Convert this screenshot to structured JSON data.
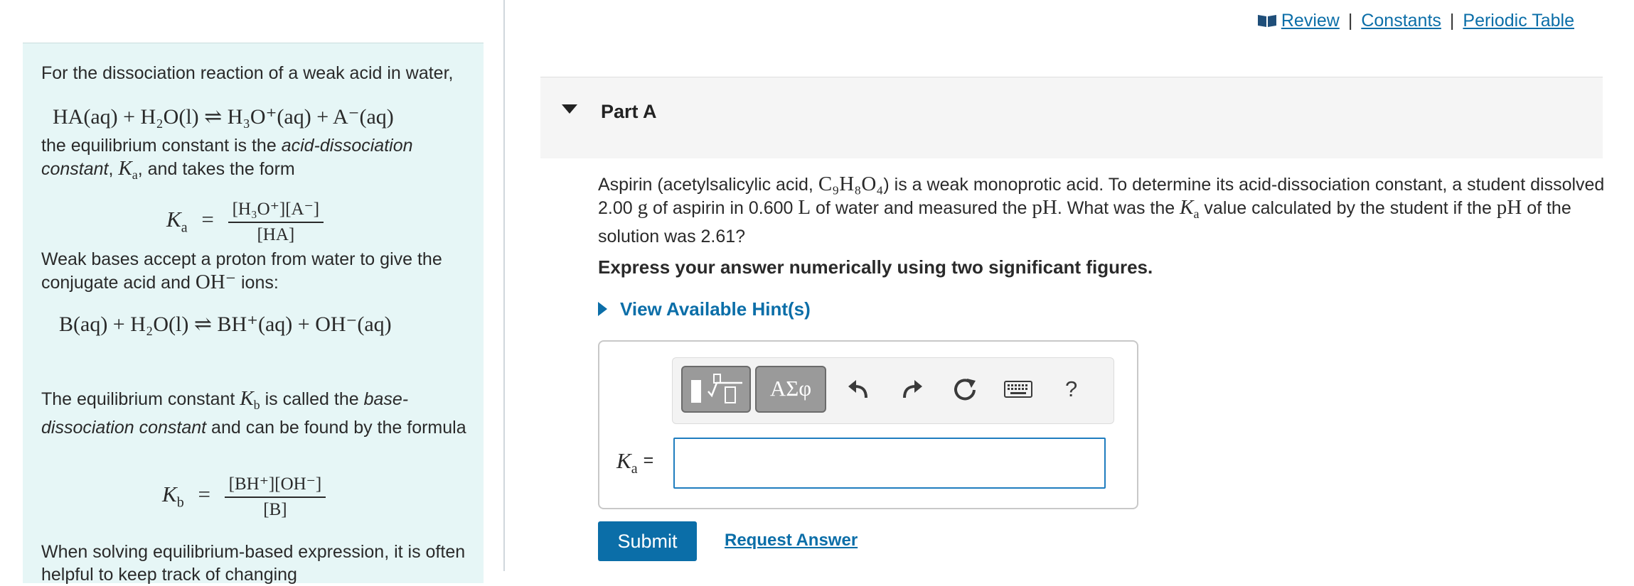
{
  "left_panel": {
    "intro": "For the dissociation reaction of a weak acid in water,",
    "eq_acid_dissociation": "HA(aq) + H₂O(l) ⇌ H₃O⁺(aq) + A⁻(aq)",
    "ka_text_pre": "the equilibrium constant is the ",
    "ka_text_term": "acid-dissociation constant",
    "ka_text_sym": "K",
    "ka_text_sub": "a",
    "ka_text_post": ", and takes the form",
    "ka_formula": {
      "symbol": "K",
      "sub": "a",
      "numerator": "[H₃O⁺][A⁻]",
      "denominator": "[HA]"
    },
    "bases_pre": "Weak bases accept a proton from water to give the conjugate acid and ",
    "bases_ion": "OH⁻",
    "bases_post": " ions:",
    "eq_base_dissociation": "B(aq) + H₂O(l) ⇌ BH⁺(aq) + OH⁻(aq)",
    "kb_text_pre": "The equilibrium constant ",
    "kb_text_sym": "K",
    "kb_text_sub": "b",
    "kb_text_mid": " is called the ",
    "kb_text_term": "base-dissociation constant",
    "kb_text_post": " and can be found by the formula",
    "kb_formula": {
      "symbol": "K",
      "sub": "b",
      "numerator": "[BH⁺][OH⁻]",
      "denominator": "[B]"
    },
    "solving_text": "When solving equilibrium-based expression, it is often helpful to keep track of changing"
  },
  "top_links": {
    "review": "Review",
    "separator": "|",
    "constants": "Constants",
    "periodic_table": "Periodic Table"
  },
  "part": {
    "title": "Part A"
  },
  "question": {
    "text1": "Aspirin (acetylsalicylic acid, ",
    "formula": "C₉H₈O₄",
    "text2": ") is a weak monoprotic acid. To determine its acid-dissociation constant, a student dissolved 2.00 ",
    "unit_g": "g",
    "text3": " of aspirin in 0.600 ",
    "unit_l": "L",
    "text4": " of water and measured the ",
    "ph1": "pH",
    "text5": ". What was the ",
    "ka_sym": "K",
    "ka_sub": "a",
    "text6": " value calculated by the student if the ",
    "ph2": "pH",
    "text7": " of the solution was 2.61?"
  },
  "instruction": "Express your answer numerically using two significant figures.",
  "hint_label": "View Available Hint(s)",
  "toolbar": {
    "templates_icon": "templates-icon",
    "greek_label": "ΑΣφ",
    "undo_icon": "undo-icon",
    "redo_icon": "redo-icon",
    "reset_icon": "reset-icon",
    "keyboard_icon": "keyboard-icon",
    "help_label": "?"
  },
  "answer": {
    "label_sym": "K",
    "label_sub": "a",
    "label_eq": "=",
    "value": ""
  },
  "buttons": {
    "submit": "Submit",
    "request_answer": "Request Answer"
  },
  "colors": {
    "link": "#0b6ea8",
    "panel_bg": "#e6f6f6",
    "submit_bg": "#0b6ea8",
    "input_border": "#1f7dbf"
  }
}
